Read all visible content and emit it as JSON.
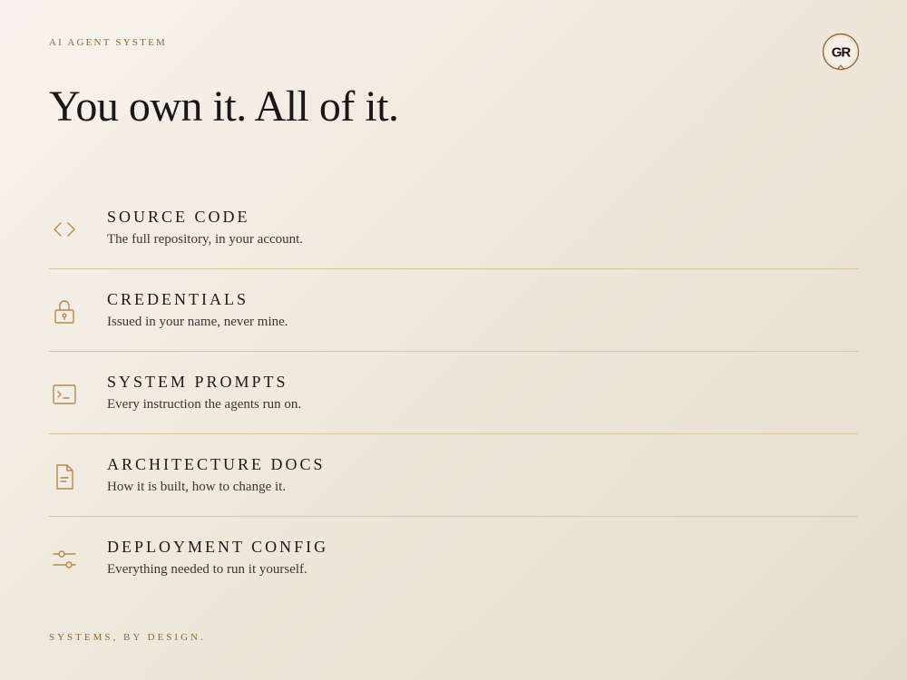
{
  "eyebrow": "AI AGENT SYSTEM",
  "logo": {
    "text": "GR",
    "icon": "gr-monogram-logo"
  },
  "headline": "You own it. All of it.",
  "accent_color": "#b08a58",
  "divider_color": "#d5c5a8",
  "items": [
    {
      "icon": "code-brackets-icon",
      "title": "SOURCE CODE",
      "description": "The full repository, in your account."
    },
    {
      "icon": "padlock-icon",
      "title": "CREDENTIALS",
      "description": "Issued in your name, never mine."
    },
    {
      "icon": "terminal-icon",
      "title": "SYSTEM PROMPTS",
      "description": "Every instruction the agents run on."
    },
    {
      "icon": "document-icon",
      "title": "ARCHITECTURE DOCS",
      "description": "How it is built, how to change it."
    },
    {
      "icon": "sliders-icon",
      "title": "DEPLOYMENT CONFIG",
      "description": "Everything needed to run it yourself."
    }
  ],
  "footer": "SYSTEMS, BY DESIGN."
}
